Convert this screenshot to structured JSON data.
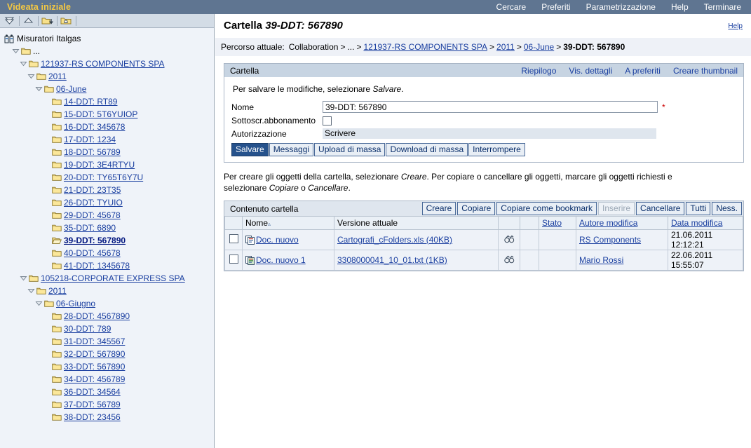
{
  "topbar": {
    "title": "Videata iniziale",
    "nav": [
      {
        "label": "Cercare",
        "name": "topnav-cercare"
      },
      {
        "label": "Preferiti",
        "name": "topnav-preferiti"
      },
      {
        "label": "Parametrizzazione",
        "name": "topnav-parametrizzazione"
      },
      {
        "label": "Help",
        "name": "topnav-help"
      },
      {
        "label": "Terminare",
        "name": "topnav-terminare"
      }
    ]
  },
  "sidebar": {
    "toolbar": [
      {
        "name": "collapse-all-icon",
        "title": "Comprimere tutto"
      },
      {
        "name": "expand-up-icon",
        "title": "Livello superiore"
      },
      {
        "name": "folder-down-icon",
        "title": "Cartella giù"
      },
      {
        "name": "folder-home-icon",
        "title": "Cartella iniziale"
      }
    ],
    "root": {
      "label": "Misuratori Italgas",
      "icon": "collaboration-icon"
    },
    "tree": [
      {
        "label": "...",
        "depth": 1,
        "expanded": true,
        "link": false,
        "icon": "folder-icon"
      },
      {
        "label": "121937-RS COMPONENTS SPA",
        "depth": 2,
        "expanded": true,
        "link": true,
        "icon": "folder-icon"
      },
      {
        "label": "2011",
        "depth": 3,
        "expanded": true,
        "link": true,
        "icon": "folder-icon"
      },
      {
        "label": "06-June",
        "depth": 4,
        "expanded": true,
        "link": true,
        "icon": "folder-icon"
      },
      {
        "label": "14-DDT: RT89",
        "depth": 5,
        "expanded": false,
        "link": true,
        "icon": "folder-icon"
      },
      {
        "label": "15-DDT: 5T6YUIOP",
        "depth": 5,
        "expanded": false,
        "link": true,
        "icon": "folder-icon"
      },
      {
        "label": "16-DDT: 345678",
        "depth": 5,
        "expanded": false,
        "link": true,
        "icon": "folder-icon"
      },
      {
        "label": "17-DDT: 1234",
        "depth": 5,
        "expanded": false,
        "link": true,
        "icon": "folder-icon"
      },
      {
        "label": "18-DDT: 56789",
        "depth": 5,
        "expanded": false,
        "link": true,
        "icon": "folder-icon"
      },
      {
        "label": "19-DDT: 3E4RTYU",
        "depth": 5,
        "expanded": false,
        "link": true,
        "icon": "folder-icon"
      },
      {
        "label": "20-DDT: TY65T6Y7U",
        "depth": 5,
        "expanded": false,
        "link": true,
        "icon": "folder-icon"
      },
      {
        "label": "21-DDT: 23T35",
        "depth": 5,
        "expanded": false,
        "link": true,
        "icon": "folder-icon"
      },
      {
        "label": "26-DDT: TYUIO",
        "depth": 5,
        "expanded": false,
        "link": true,
        "icon": "folder-icon"
      },
      {
        "label": "29-DDT: 45678",
        "depth": 5,
        "expanded": false,
        "link": true,
        "icon": "folder-icon"
      },
      {
        "label": "35-DDT: 6890",
        "depth": 5,
        "expanded": false,
        "link": true,
        "icon": "folder-icon"
      },
      {
        "label": "39-DDT: 567890",
        "depth": 5,
        "expanded": false,
        "link": true,
        "icon": "folder-open-icon",
        "selected": true
      },
      {
        "label": "40-DDT: 45678",
        "depth": 5,
        "expanded": false,
        "link": true,
        "icon": "folder-icon"
      },
      {
        "label": "41-DDT: 1345678",
        "depth": 5,
        "expanded": false,
        "link": true,
        "icon": "folder-icon"
      },
      {
        "label": "105218-CORPORATE EXPRESS SPA",
        "depth": 2,
        "expanded": true,
        "link": true,
        "icon": "folder-icon"
      },
      {
        "label": "2011",
        "depth": 3,
        "expanded": true,
        "link": true,
        "icon": "folder-icon"
      },
      {
        "label": "06-Giugno",
        "depth": 4,
        "expanded": true,
        "link": true,
        "icon": "folder-icon"
      },
      {
        "label": "28-DDT: 4567890",
        "depth": 5,
        "expanded": false,
        "link": true,
        "icon": "folder-icon"
      },
      {
        "label": "30-DDT: 789",
        "depth": 5,
        "expanded": false,
        "link": true,
        "icon": "folder-icon"
      },
      {
        "label": "31-DDT: 345567",
        "depth": 5,
        "expanded": false,
        "link": true,
        "icon": "folder-icon"
      },
      {
        "label": "32-DDT: 567890",
        "depth": 5,
        "expanded": false,
        "link": true,
        "icon": "folder-icon"
      },
      {
        "label": "33-DDT: 567890",
        "depth": 5,
        "expanded": false,
        "link": true,
        "icon": "folder-icon"
      },
      {
        "label": "34-DDT: 456789",
        "depth": 5,
        "expanded": false,
        "link": true,
        "icon": "folder-icon"
      },
      {
        "label": "36-DDT: 34564",
        "depth": 5,
        "expanded": false,
        "link": true,
        "icon": "folder-icon"
      },
      {
        "label": "37-DDT: 56789",
        "depth": 5,
        "expanded": false,
        "link": true,
        "icon": "folder-icon"
      },
      {
        "label": "38-DDT: 23456",
        "depth": 5,
        "expanded": false,
        "link": true,
        "icon": "folder-icon"
      }
    ]
  },
  "page": {
    "title_prefix": "Cartella",
    "title_value": "39-DDT: 567890",
    "help_label": "Help",
    "breadcrumb_label": "Percorso attuale:",
    "breadcrumb": [
      {
        "label": "Collaboration",
        "link": false
      },
      {
        "label": "...",
        "link": false
      },
      {
        "label": "121937-RS COMPONENTS SPA",
        "link": true
      },
      {
        "label": "2011",
        "link": true
      },
      {
        "label": "06-June",
        "link": true
      },
      {
        "label": "39-DDT: 567890",
        "link": false,
        "current": true
      }
    ],
    "breadcrumb_separator": ">"
  },
  "folder_panel": {
    "head_title": "Cartella",
    "head_links": [
      {
        "label": "Riepilogo",
        "name": "link-riepilogo"
      },
      {
        "label": "Vis. dettagli",
        "name": "link-vis-dettagli"
      },
      {
        "label": "A preferiti",
        "name": "link-a-preferiti"
      },
      {
        "label": "Creare thumbnail",
        "name": "link-creare-thumbnail"
      }
    ],
    "hint_before": "Per salvare le modifiche, selezionare ",
    "hint_em": "Salvare",
    "hint_after": ".",
    "fields": {
      "name_label": "Nome",
      "name_value": "39-DDT: 567890",
      "name_required_marker": "*",
      "subscription_label": "Sottoscr.abbonamento",
      "subscription_checked": false,
      "authorization_label": "Autorizzazione",
      "authorization_value": "Scrivere"
    },
    "buttons": [
      {
        "label": "Salvare",
        "name": "save-button",
        "style": "primary"
      },
      {
        "label": "Messaggi",
        "name": "messages-button",
        "style": "normal"
      },
      {
        "label": "Upload di massa",
        "name": "mass-upload-button",
        "style": "normal"
      },
      {
        "label": "Download di massa",
        "name": "mass-download-button",
        "style": "normal"
      },
      {
        "label": "Interrompere",
        "name": "cancel-button",
        "style": "normal"
      }
    ]
  },
  "instruction": {
    "p1": "Per creare gli oggetti della cartella, selezionare ",
    "em1": "Creare",
    "p2": ". Per copiare o cancellare gli oggetti, marcare gli oggetti richiesti e selezionare ",
    "em2": "Copiare",
    "p3": " o ",
    "em3": "Cancellare",
    "p4": "."
  },
  "content_table": {
    "title": "Contenuto cartella",
    "toolbar": [
      {
        "label": "Creare",
        "name": "create-button",
        "disabled": false
      },
      {
        "label": "Copiare",
        "name": "copy-button",
        "disabled": false
      },
      {
        "label": "Copiare come bookmark",
        "name": "copy-as-bookmark-button",
        "disabled": false
      },
      {
        "label": "Inserire",
        "name": "paste-button",
        "disabled": true
      },
      {
        "label": "Cancellare",
        "name": "delete-button",
        "disabled": false
      },
      {
        "label": "Tutti",
        "name": "select-all-button",
        "disabled": false
      },
      {
        "label": "Ness.",
        "name": "select-none-button",
        "disabled": false
      }
    ],
    "columns": [
      {
        "label": "",
        "name": "col-checkbox",
        "sortable": false
      },
      {
        "label": "Nome",
        "name": "col-nome",
        "sortable": false,
        "sorted": "asc"
      },
      {
        "label": "Versione attuale",
        "name": "col-versione-attuale",
        "sortable": false
      },
      {
        "label": "",
        "name": "col-view-icon",
        "sortable": false
      },
      {
        "label": "",
        "name": "col-spacer",
        "sortable": false
      },
      {
        "label": "Stato",
        "name": "col-stato",
        "sortable": true
      },
      {
        "label": "Autore modifica",
        "name": "col-autore-modifica",
        "sortable": true
      },
      {
        "label": "Data modifica",
        "name": "col-data-modifica",
        "sortable": true
      }
    ],
    "rows": [
      {
        "checked": false,
        "icon": "document-icon",
        "name": "Doc. nuovo",
        "version": "Cartografi_cFolders.xls (40KB)",
        "view_icon": "binoculars-icon",
        "stato": "",
        "autore": "RS Components",
        "data": "21.06.2011 12:12:21"
      },
      {
        "checked": false,
        "icon": "document-green-icon",
        "name": "Doc. nuovo 1",
        "version": "3308000041_10_01.txt (1KB)",
        "view_icon": "binoculars-icon",
        "stato": "",
        "autore": "Mario Rossi",
        "data": "22.06.2011 15:55:07"
      }
    ]
  },
  "colors": {
    "topbar_bg": "#5f7591",
    "topbar_title": "#f5c842",
    "link": "#1a3fa0",
    "panel_head": "#c7d4e2",
    "primary_button": "#26528c",
    "required": "#cc0000"
  }
}
